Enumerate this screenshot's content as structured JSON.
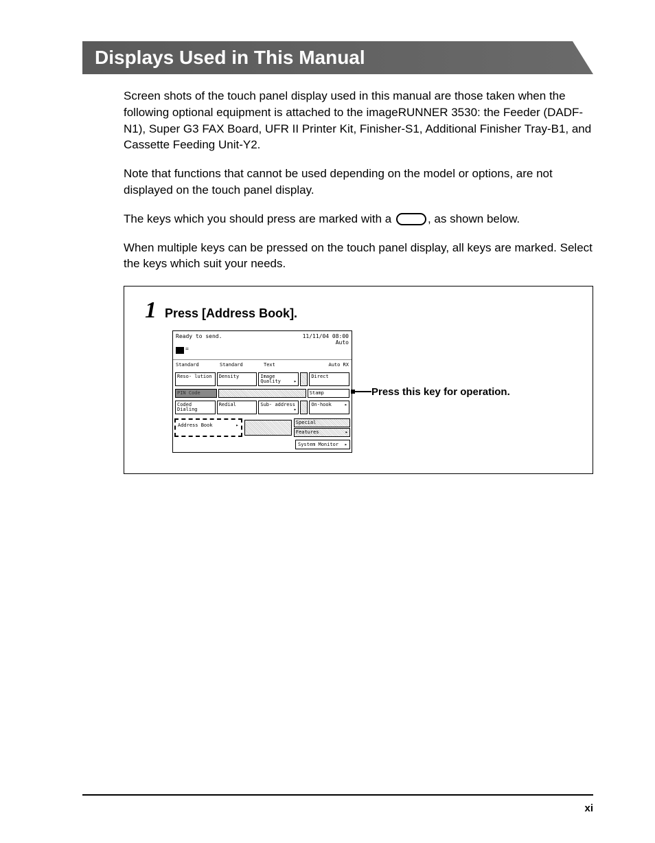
{
  "heading": "Displays Used in This Manual",
  "paragraphs": {
    "p1": "Screen shots of the touch panel display used in this manual are those taken when the following optional equipment is attached to the imageRUNNER 3530: the Feeder (DADF-N1), Super G3 FAX Board, UFR II Printer Kit, Finisher-S1, Additional Finisher Tray-B1, and Cassette Feeding Unit-Y2.",
    "p2": "Note that functions that cannot be used depending on the model or options, are not displayed on the touch panel display.",
    "p3_before": "The keys which you should press are marked with a ",
    "p3_after": ", as shown below.",
    "p4": "When multiple keys can be pressed on the touch panel display, all keys are marked. Select the keys which suit your needs."
  },
  "step": {
    "number": "1",
    "text": "Press [Address Book]."
  },
  "fax_screen": {
    "status": "Ready to send.",
    "datetime": "11/11/04 08:00",
    "mode": "Auto",
    "info_row": {
      "c1": "Standard",
      "c2": "Standard",
      "c3": "Text",
      "c4": "Auto RX"
    },
    "buttons_row2": {
      "resolution": "Reso-\nlution",
      "density": "Density",
      "image_quality": "Image\nQuality",
      "direct": "Direct"
    },
    "buttons_row3": {
      "pin_code": "PIN Code",
      "stamp": "Stamp"
    },
    "buttons_row4": {
      "coded_dialing": "Coded\nDialing",
      "redial": "Redial",
      "subaddress": "Sub-\naddress",
      "on_hook": "On-hook"
    },
    "bottom": {
      "address_book": "Address Book",
      "special": "Special",
      "features": "Features",
      "system_monitor": "System Monitor"
    }
  },
  "callout": "Press this key for operation.",
  "page_number": "xi"
}
